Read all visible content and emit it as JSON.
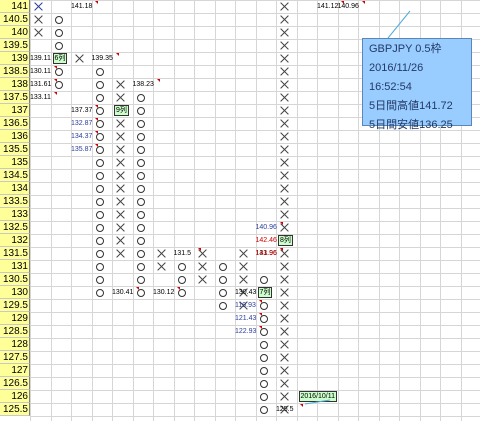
{
  "colors": {
    "row_header_bg": "#ffff99",
    "x_mark": "#444444",
    "o_mark": "#333333",
    "red_text": "#d00000",
    "blue_text": "#2c3e9c",
    "callout_bg": "#ccffcc",
    "info_bg": "#99ccff"
  },
  "row_labels": [
    "141",
    "140.5",
    "140",
    "139.5",
    "139",
    "138.5",
    "138",
    "137.5",
    "137",
    "136.5",
    "136",
    "135.5",
    "135",
    "134.5",
    "134",
    "133.5",
    "133",
    "132.5",
    "132",
    "131.5",
    "131",
    "130.5",
    "130",
    "129.5",
    "129",
    "128.5",
    "128",
    "127.5",
    "127",
    "126.5",
    "126",
    "125.5"
  ],
  "columns": [
    {
      "id": 1,
      "type": "X",
      "top": "141",
      "bottom": "140"
    },
    {
      "id": 2,
      "type": "O",
      "top": "140.5",
      "bottom": "138"
    },
    {
      "id": 3,
      "type": "X",
      "top": "139",
      "bottom": "139"
    },
    {
      "id": 4,
      "type": "O",
      "top": "138.5",
      "bottom": "130"
    },
    {
      "id": 5,
      "type": "X",
      "top": "138",
      "bottom": "131.5"
    },
    {
      "id": 6,
      "type": "O",
      "top": "137.5",
      "bottom": "130"
    },
    {
      "id": 7,
      "type": "X",
      "top": "131.5",
      "bottom": "131"
    },
    {
      "id": 8,
      "type": "O",
      "top": "131",
      "bottom": "130"
    },
    {
      "id": 9,
      "type": "X",
      "top": "131.5",
      "bottom": "130.5"
    },
    {
      "id": 10,
      "type": "O",
      "top": "131",
      "bottom": "129.5"
    },
    {
      "id": 11,
      "type": "X",
      "top": "131.5",
      "bottom": "129.5"
    },
    {
      "id": 12,
      "type": "O",
      "top": "130.5",
      "bottom": "125.5"
    },
    {
      "id": 13,
      "type": "X",
      "top": "141",
      "bottom": "125.5"
    }
  ],
  "price_labels": [
    {
      "text": "141.18",
      "color": "black",
      "row": "141",
      "col": 3
    },
    {
      "text": "139.11",
      "color": "black",
      "row": "139",
      "col": 1
    },
    {
      "text": "130.11",
      "color": "black",
      "row": "138.5",
      "col": 1
    },
    {
      "text": "131.61",
      "color": "black",
      "row": "138",
      "col": 1
    },
    {
      "text": "133.11",
      "color": "black",
      "row": "137.5",
      "col": 1
    },
    {
      "text": "139.35",
      "color": "black",
      "row": "139",
      "col": 4
    },
    {
      "text": "138.23",
      "color": "black",
      "row": "138",
      "col": 6
    },
    {
      "text": "137.37",
      "color": "black",
      "row": "137",
      "col": 3
    },
    {
      "text": "132.87",
      "color": "blue",
      "row": "136.5",
      "col": 3
    },
    {
      "text": "134.37",
      "color": "blue",
      "row": "136",
      "col": 3
    },
    {
      "text": "135.87",
      "color": "blue",
      "row": "135.5",
      "col": 3
    },
    {
      "text": "130.41",
      "color": "black",
      "row": "130",
      "col": 5
    },
    {
      "text": "131.5",
      "color": "black",
      "row": "131.5",
      "col": 8
    },
    {
      "text": "130.12",
      "color": "black",
      "row": "130",
      "col": 7
    },
    {
      "text": "131.96",
      "color": "black",
      "row": "131.5",
      "col": 12
    },
    {
      "text": "140.96",
      "color": "blue",
      "row": "132.5",
      "col": 12
    },
    {
      "text": "142.46",
      "color": "red",
      "row": "132",
      "col": 12
    },
    {
      "text": "143.96",
      "color": "red",
      "row": "131.5",
      "col": 12
    },
    {
      "text": "130.43",
      "color": "black",
      "row": "130",
      "col": 11
    },
    {
      "text": "119.93",
      "color": "blue",
      "row": "129.5",
      "col": 11
    },
    {
      "text": "121.43",
      "color": "blue",
      "row": "129",
      "col": 11
    },
    {
      "text": "122.93",
      "color": "blue",
      "row": "128.5",
      "col": 11
    },
    {
      "text": "141.12",
      "color": "black",
      "row": "141",
      "col": 15
    },
    {
      "text": "140.96",
      "color": "black",
      "row": "141",
      "col": 16
    },
    {
      "text": "125.5",
      "color": "black",
      "row": "125.5",
      "col": 13
    }
  ],
  "callouts": [
    {
      "text": "6列",
      "row": "139",
      "col": 2
    },
    {
      "text": "9列",
      "row": "137",
      "col": 5
    },
    {
      "text": "8列",
      "row": "132",
      "col": 13
    },
    {
      "text": "7列",
      "row": "130",
      "col": 12
    },
    {
      "text": "2016/10/11",
      "row": "126",
      "col": 14
    }
  ],
  "info_box": {
    "title": "GBPJPY 0.5枠",
    "date": "2016/11/26",
    "time": "16:52:54",
    "high_label": "5日間高値141.72",
    "low_label": "5日間安値136.25"
  }
}
